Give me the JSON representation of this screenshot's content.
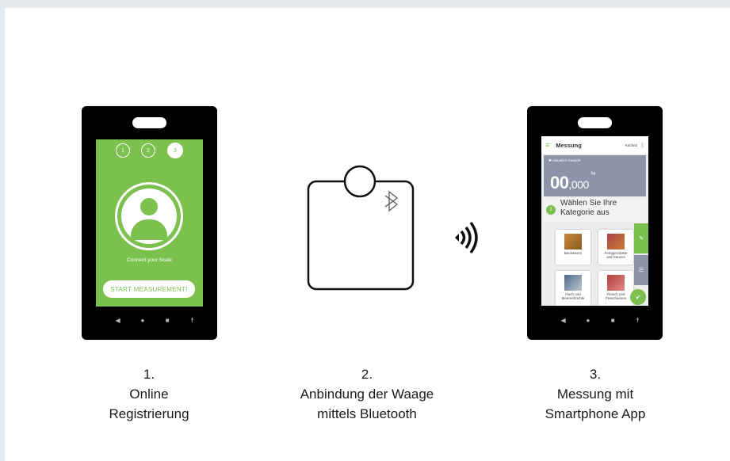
{
  "steps": [
    {
      "number": "1.",
      "line1": "Online",
      "line2": "Registrierung"
    },
    {
      "number": "2.",
      "line1": "Anbindung der Waage",
      "line2": "mittels Bluetooth"
    },
    {
      "number": "3.",
      "line1": "Messung mit",
      "line2": "Smartphone App"
    }
  ],
  "phone1": {
    "progress": [
      "1",
      "2",
      "3"
    ],
    "connect_text": "Connect your Scale",
    "start_button": "START MEASUREMENT!"
  },
  "phone3": {
    "title": "Messung",
    "location": "Küche2",
    "weight_label": "Aktuelles Gewicht",
    "unit": "kg",
    "weight_int": "00",
    "weight_dec": ",000",
    "step_number": "2",
    "step_text_line1": "Wählen Sie Ihre",
    "step_text_line2": "Kategorie aus",
    "categories": [
      {
        "line1": "Backwaren",
        "line2": ""
      },
      {
        "line1": "Fertigprodukte",
        "line2": "und Saucen"
      },
      {
        "line1": "Fisch und",
        "line2": "Meeresfrüchte"
      },
      {
        "line1": "Fleisch und",
        "line2": "Fleischwaren"
      }
    ]
  },
  "colors": {
    "accent_green": "#7cc04e",
    "weight_card": "#8b95a7"
  },
  "icons": {
    "scale_bluetooth": "bluetooth-icon",
    "signal": "wireless-signal-icon"
  }
}
